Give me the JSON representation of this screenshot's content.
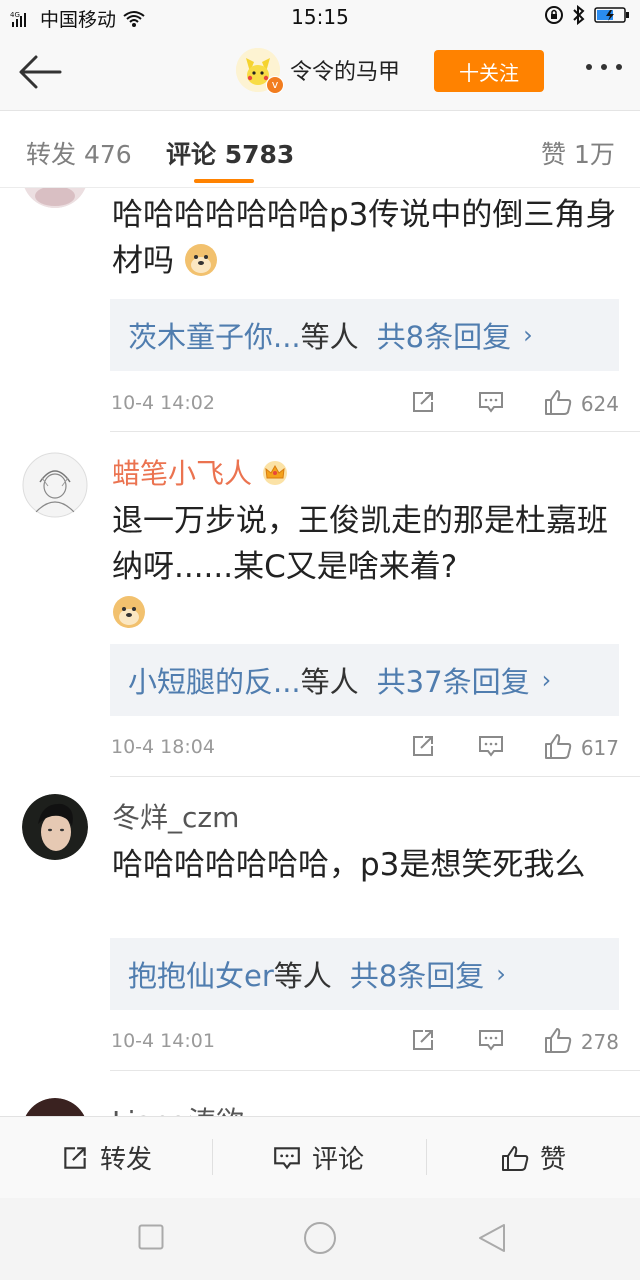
{
  "status_bar": {
    "carrier": "中国移动",
    "network": "4G",
    "time": "15:15"
  },
  "header": {
    "username": "令令的马甲",
    "follow_label": "十关注"
  },
  "tabs": {
    "repost": "转发 476",
    "comments": "评论 5783",
    "likes": "赞 1万"
  },
  "comments": [
    {
      "name": "",
      "text": "哈哈哈哈哈哈哈p3传说中的倒三角身材吗",
      "has_emoji": true,
      "replies_who": "茨木童子你...",
      "replies_etc": "等人",
      "replies_total": "共8条回复",
      "time": "10-4 14:02",
      "likes": "624"
    },
    {
      "name": "蜡笔小飞人",
      "text": "退一万步说，王俊凯走的那是杜嘉班纳呀......某C又是啥来着?",
      "has_emoji": true,
      "replies_who": "小短腿的反...",
      "replies_etc": "等人",
      "replies_total": "共37条回复",
      "time": "10-4 18:04",
      "likes": "617"
    },
    {
      "name": "冬烊_czm",
      "text": "哈哈哈哈哈哈哈，p3是想笑死我么",
      "has_emoji": false,
      "replies_who": "抱抱仙女er",
      "replies_etc": "等人",
      "replies_total": "共8条回复",
      "time": "10-4 14:01",
      "likes": "278"
    },
    {
      "name": "Liang涛欲"
    }
  ],
  "bottom_bar": {
    "repost": "转发",
    "comment": "评论",
    "like": "赞"
  },
  "icons": {
    "back": "back-arrow-icon",
    "more": "more-dots-icon",
    "repost": "repost-icon",
    "comment": "comment-icon",
    "like": "thumbs-up-icon",
    "crown": "crown-badge-icon",
    "emoji": "doge-emoji-icon"
  },
  "colors": {
    "accent": "#ff8200",
    "link": "#507daf",
    "vip_name": "#eb7350"
  }
}
